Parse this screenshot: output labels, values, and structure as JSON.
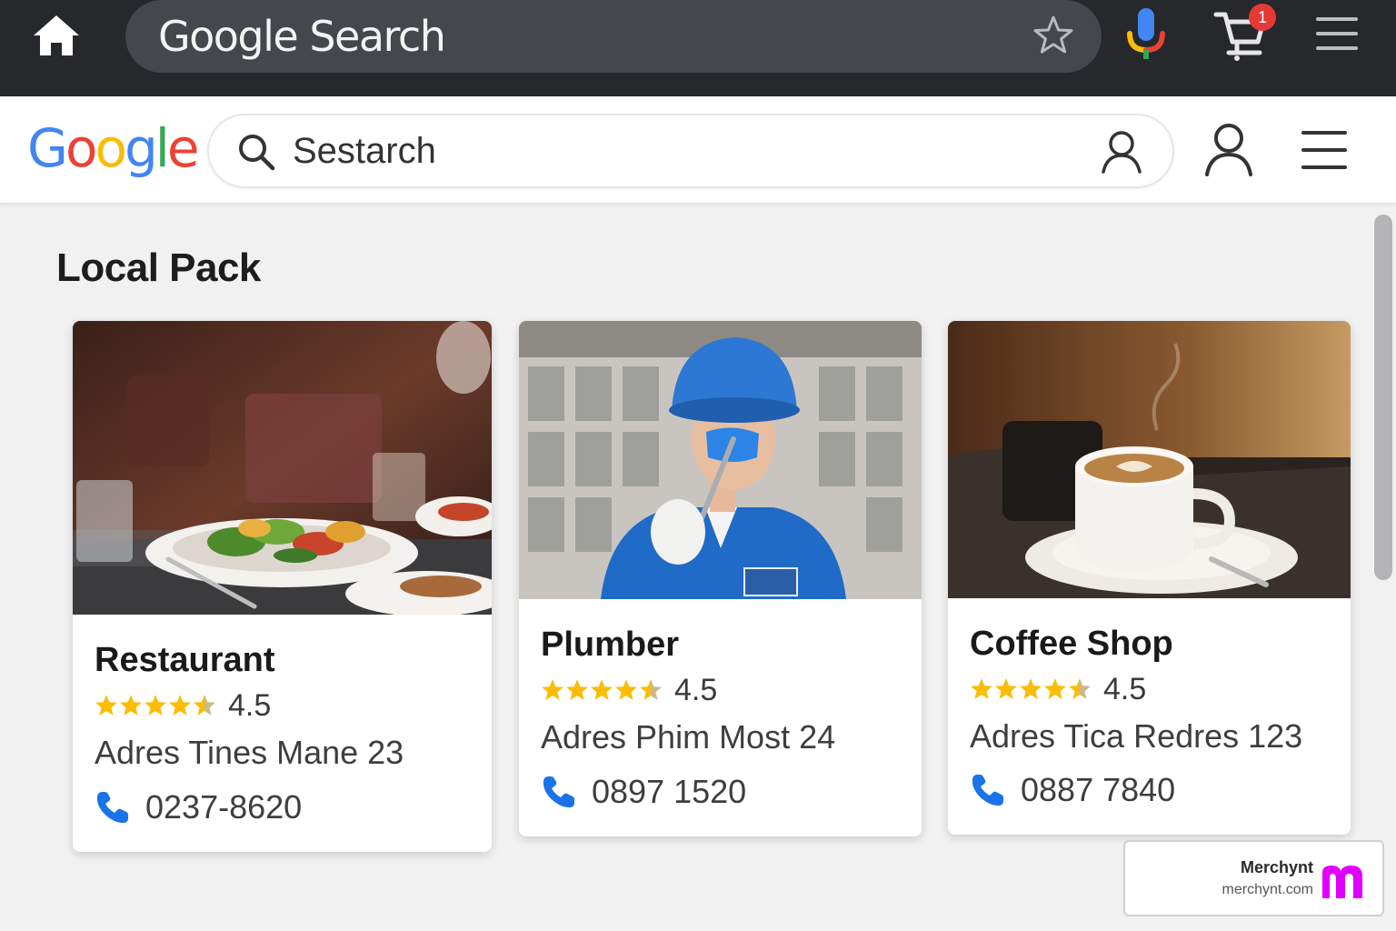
{
  "browser": {
    "omnibox_text": "Google Search",
    "cart_badge_count": "1",
    "icons": [
      "home-icon",
      "star-icon",
      "mic-icon",
      "cart-icon",
      "menu-icon"
    ]
  },
  "header": {
    "logo_text": [
      "G",
      "o",
      "o",
      "g",
      "l",
      "e"
    ],
    "logo_colors": [
      "#4285F4",
      "#EA4335",
      "#FBBC05",
      "#4285F4",
      "#34A853",
      "#EA4335"
    ],
    "search_value": "Sestarch"
  },
  "main": {
    "section_title": "Local Pack",
    "cards": [
      {
        "name": "Restaurant",
        "rating": "4.5",
        "rating_value": 4.5,
        "address": "Adres Tines Mane 23",
        "phone": "0237-8620",
        "photo": "restaurant-salad-photo"
      },
      {
        "name": "Plumber",
        "rating": "4.5",
        "rating_value": 4.5,
        "address": "Adres Phim Most 24",
        "phone": "0897 1520",
        "photo": "plumber-worker-photo"
      },
      {
        "name": "Coffee Shop",
        "rating": "4.5",
        "rating_value": 4.5,
        "address": "Adres Tica Redres 123",
        "phone": "0887 7840",
        "photo": "coffee-cup-photo"
      }
    ]
  },
  "watermark": {
    "name": "Merchynt",
    "url": "merchynt.com"
  },
  "colors": {
    "topbar": "#26282b",
    "omnibox": "#44474c",
    "star_gold": "#FBBC05",
    "phone_blue": "#1a73e8",
    "badge_red": "#e53935",
    "merchynt_magenta": "#e100ff"
  }
}
